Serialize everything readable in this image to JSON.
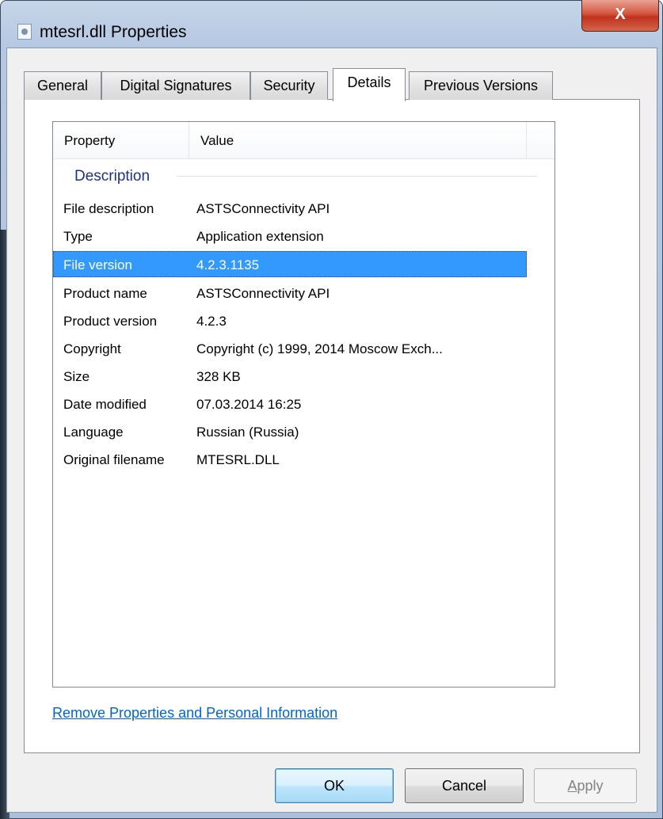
{
  "window": {
    "title": "mtesrl.dll Properties",
    "close_label": "X"
  },
  "tabs": [
    {
      "label": "General"
    },
    {
      "label": "Digital Signatures"
    },
    {
      "label": "Security"
    },
    {
      "label": "Details",
      "active": true
    },
    {
      "label": "Previous Versions"
    }
  ],
  "list": {
    "columns": [
      "Property",
      "Value"
    ],
    "group": "Description",
    "rows": [
      {
        "property": "File description",
        "value": "ASTSConnectivity API"
      },
      {
        "property": "Type",
        "value": "Application extension"
      },
      {
        "property": "File version",
        "value": "4.2.3.1135",
        "selected": true
      },
      {
        "property": "Product name",
        "value": "ASTSConnectivity API"
      },
      {
        "property": "Product version",
        "value": "4.2.3"
      },
      {
        "property": "Copyright",
        "value": "Copyright (c) 1999, 2014 Moscow Exch..."
      },
      {
        "property": "Size",
        "value": "328 KB"
      },
      {
        "property": "Date modified",
        "value": "07.03.2014 16:25"
      },
      {
        "property": "Language",
        "value": "Russian (Russia)"
      },
      {
        "property": "Original filename",
        "value": "MTESRL.DLL"
      }
    ]
  },
  "remove_link": "Remove Properties and Personal Information",
  "buttons": {
    "ok": "OK",
    "cancel": "Cancel",
    "apply_underlined": "A",
    "apply_rest": "pply"
  },
  "colors": {
    "selection": "#3399ff",
    "group_header": "#1e3287",
    "link": "#0066cc"
  }
}
